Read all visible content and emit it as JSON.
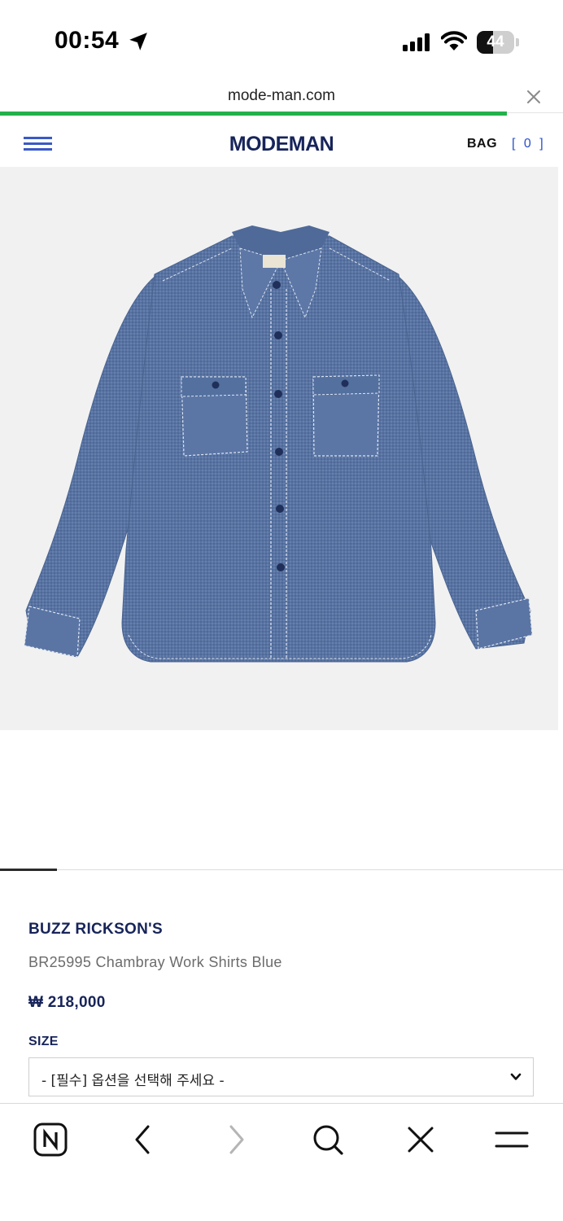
{
  "status_bar": {
    "time": "00:54",
    "battery_level": "44",
    "icons": [
      "location-arrow-icon",
      "cellular-signal-icon",
      "wifi-icon",
      "battery-icon"
    ]
  },
  "browser": {
    "url": "mode-man.com",
    "load_progress": 0.9,
    "toolbar_icons": [
      "naver-home-icon",
      "back-icon",
      "forward-icon",
      "search-icon",
      "close-icon",
      "menu-icon"
    ]
  },
  "header": {
    "logo": "MODEMAN",
    "bag_label": "BAG",
    "bag_count": "[ 0 ]"
  },
  "product": {
    "image_subject": "chambray work shirt",
    "brand": "BUZZ RICKSON'S",
    "name": "BR25995 Chambray Work Shirts Blue",
    "price": "₩ 218,000",
    "size_label": "SIZE",
    "size_select_value": "- [필수] 옵션을 선택해 주세요 -"
  },
  "colors": {
    "accent_blue": "#2c4fc7",
    "navy_text": "#17245a",
    "progress_green": "#22b14c",
    "image_bg": "#f1f1f1"
  }
}
